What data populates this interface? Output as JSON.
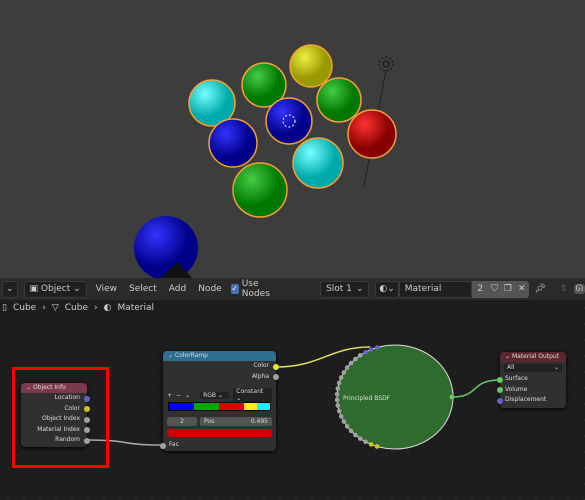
{
  "header": {
    "mode": "Object",
    "menus": [
      "View",
      "Select",
      "Add",
      "Node"
    ],
    "use_nodes_label": "Use Nodes",
    "use_nodes_checked": true,
    "slot": "Slot 1",
    "material": "Material",
    "users": "2"
  },
  "breadcrumb": [
    "Cube",
    "Cube",
    "Material"
  ],
  "nodes": {
    "object_info": {
      "title": "Object Info",
      "outputs": [
        "Location",
        "Color",
        "Object Index",
        "Material Index",
        "Random"
      ]
    },
    "color_ramp": {
      "title": "ColorRamp",
      "outputs": [
        "Color",
        "Alpha"
      ],
      "buttons": [
        "+",
        "−",
        "⌄"
      ],
      "color_mode": "RGB",
      "interpolation": "Constant",
      "stop_index": "2",
      "pos_label": "Pos",
      "pos_value": "0.495",
      "input": "Fac",
      "stops": [
        "#0000ff",
        "#00aa00",
        "#dd0000",
        "#ffee00",
        "#00ffff"
      ],
      "selected_color": "#cc0000"
    },
    "principled": {
      "title": "Principled BSDF"
    },
    "material_output": {
      "title": "Material Output",
      "target": "All",
      "inputs": [
        "Surface",
        "Volume",
        "Displacement"
      ]
    }
  },
  "colors": {
    "highlight": "#ff0000",
    "selected_outline": "#ffa030",
    "shader_green": "#2e6b2e"
  }
}
